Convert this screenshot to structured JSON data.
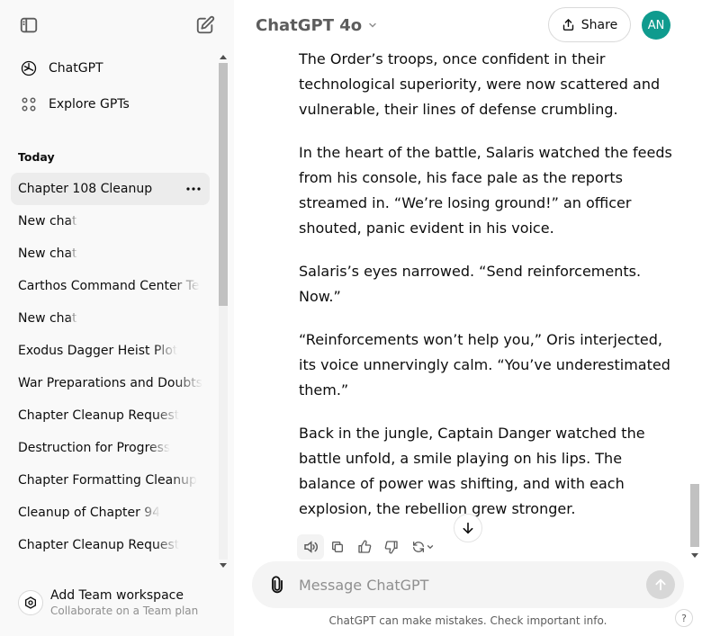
{
  "sidebar": {
    "nav": [
      {
        "label": "ChatGPT",
        "icon": "openai-logo-icon"
      },
      {
        "label": "Explore GPTs",
        "icon": "grid-icon"
      }
    ],
    "section_title": "Today",
    "chats": [
      "Chapter 108 Cleanup",
      "New chat",
      "New chat",
      "Carthos Command Center Te",
      "New chat",
      "Exodus Dagger Heist Plot",
      "War Preparations and Doubts",
      "Chapter Cleanup Request",
      "Destruction for Progress",
      "Chapter Formatting Cleanup",
      "Cleanup of Chapter 94",
      "Chapter Cleanup Request"
    ],
    "team": {
      "title": "Add Team workspace",
      "subtitle": "Collaborate on a Team plan"
    }
  },
  "header": {
    "model_name": "ChatGPT 4o",
    "share_label": "Share",
    "avatar_initials": "AN",
    "avatar_color": "#0f9b8e"
  },
  "message": {
    "paragraphs": [
      "The Order’s troops, once confident in their technological superiority, were now scattered and vulnerable, their lines of defense crumbling.",
      "In the heart of the battle, Salaris watched the feeds from his console, his face pale as the reports streamed in. “We’re losing ground!” an officer shouted, panic evident in his voice.",
      "Salaris’s eyes narrowed. “Send reinforcements. Now.”",
      "“Reinforcements won’t help you,” Oris interjected, its voice unnervingly calm. “You’ve underestimated them.”",
      "Back in the jungle, Captain Danger watched the battle unfold, a smile playing on his lips. The balance of power was shifting, and with each explosion, the rebellion grew stronger."
    ]
  },
  "composer": {
    "placeholder": "Message ChatGPT"
  },
  "footer": {
    "disclaimer": "ChatGPT can make mistakes. Check important info.",
    "help": "?"
  }
}
